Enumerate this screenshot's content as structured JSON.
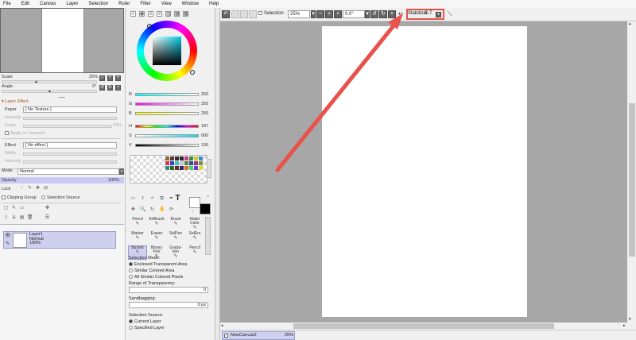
{
  "menu": [
    "File",
    "Edit",
    "Canvas",
    "Layer",
    "Selection",
    "Ruler",
    "Filter",
    "View",
    "Window",
    "Help"
  ],
  "navigator": {
    "scale_label": "Scale",
    "scale_value": "25%",
    "angle_label": "Angle",
    "angle_value": "0°"
  },
  "layer_effect": {
    "header": "Layer Effect",
    "paper_label": "Paper",
    "paper_value": "[ No Texture ]",
    "intensity_label": "Intensity",
    "scale_label": "Scale",
    "scale_value": "10%",
    "apply_linework": "Apply to Linework",
    "effect_label": "Effect",
    "effect_value": "[ No effect ]",
    "width_label": "Width",
    "effect_intensity_label": "Intensity"
  },
  "layer_props": {
    "mode_label": "Mode",
    "mode_value": "Normal",
    "opacity_label": "Opacity",
    "opacity_value": "100%",
    "lock_label": "Lock",
    "clipping_group": "Clipping Group",
    "selection_source": "Selection Source"
  },
  "layers": [
    {
      "name": "Layer1",
      "mode": "Normal",
      "opacity": "100%"
    }
  ],
  "color": {
    "rgb": [
      {
        "label": "R",
        "value": "255"
      },
      {
        "label": "G",
        "value": "255"
      },
      {
        "label": "B",
        "value": "255"
      }
    ],
    "hsv": [
      {
        "label": "H",
        "value": "187"
      },
      {
        "label": "S",
        "value": "000"
      },
      {
        "label": "V",
        "value": "100"
      }
    ],
    "swatches": [
      "#8a6a3a",
      "#5a3a2a",
      "#3a2a2a",
      "#2a2a2a",
      "#c83c8c",
      "#3c8c3c",
      "#c8c83c",
      "#3c8cc8",
      "#c83c3c",
      "#3c3cc8",
      "#3cc8c8",
      "#c8c8c8",
      "#4a8a3a",
      "#3a4a8a",
      "#8a3a8a",
      "#8a8a3a",
      "#3a8a8a",
      "#2a6a2a",
      "#6a2a2a",
      "#2a2a6a",
      "#d86a3a",
      "#3ad86a",
      "#6a3ad8",
      "#d8d83a"
    ]
  },
  "tools": [
    {
      "label": "Pencil"
    },
    {
      "label": "AirBrush"
    },
    {
      "label": "Brush"
    },
    {
      "label": "Water Color"
    },
    {
      "label": "Marker"
    },
    {
      "label": "Eraser"
    },
    {
      "label": "SelPen"
    },
    {
      "label": "SelErs"
    },
    {
      "label": "Bucket"
    },
    {
      "label": "Binary Pen"
    },
    {
      "label": "Grada-tion"
    },
    {
      "label": "Pencil"
    }
  ],
  "bucket_opts": {
    "selection_mode_label": "Selection Mode:",
    "modes": [
      "Enclosed Transparent Area",
      "Similar Colored Area",
      "All Similar Colored Pixels"
    ],
    "range_label": "Range of Transparency:",
    "range_value": "0",
    "sandbagging_label": "Sandbagging:",
    "sandbagging_value": "0 px",
    "source_label": "Selection Source:",
    "sources": [
      "Current Layer",
      "Specified Layer"
    ]
  },
  "canvas_toolbar": {
    "selection": "Selection",
    "zoom": "25%",
    "rotation": "0.0°",
    "stabilizer_label": "Stabilizer",
    "stabilizer_value": "S-7"
  },
  "tab": {
    "name": "NewCanvas2",
    "zoom": "25%"
  },
  "colors": {
    "accent": "#e8524a",
    "layer_selected": "#cfcfee",
    "workspace": "#a7a7a7"
  }
}
